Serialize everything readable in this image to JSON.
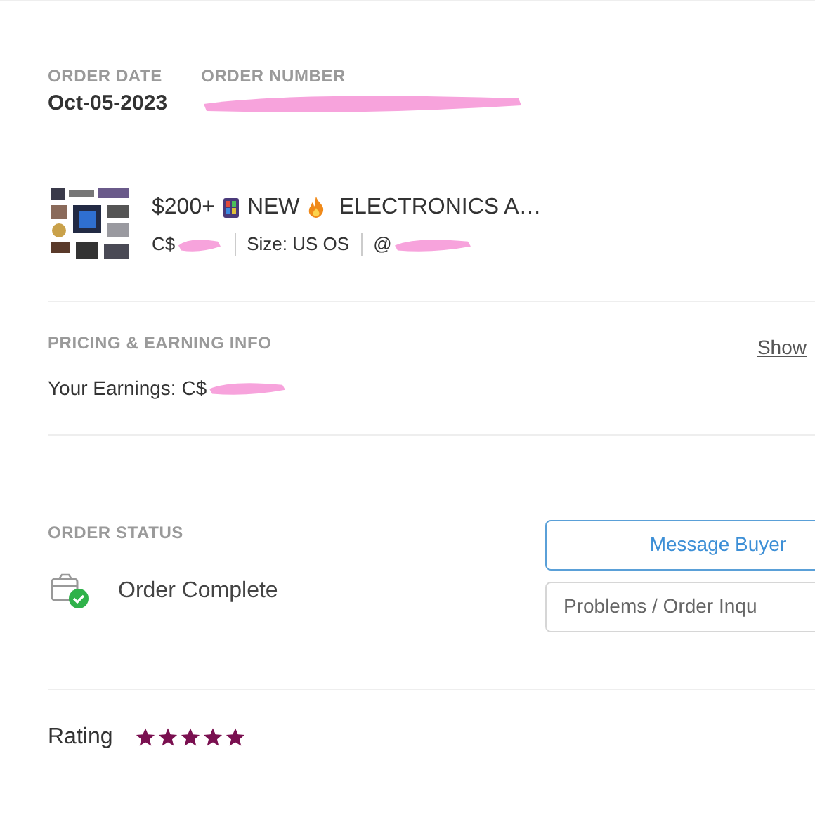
{
  "order_date": {
    "label": "ORDER DATE",
    "value": "Oct-05-2023"
  },
  "order_number": {
    "label": "ORDER NUMBER"
  },
  "item": {
    "title_parts": [
      "$200+",
      "NEW",
      "ELECTRONICS A…"
    ],
    "price": "C$",
    "size": "Size: US OS",
    "buyer": "@"
  },
  "pricing": {
    "heading": "PRICING & EARNING INFO",
    "link": "Show",
    "earnings": "Your Earnings: C$"
  },
  "status": {
    "heading": "ORDER STATUS",
    "text": "Order Complete",
    "complete": true
  },
  "buttons": [
    {
      "label": "Message Buyer",
      "kind": "primary"
    },
    {
      "label": "Problems / Order Inqu",
      "kind": "secondary"
    }
  ],
  "rating": {
    "label": "Rating",
    "stars": 5
  }
}
